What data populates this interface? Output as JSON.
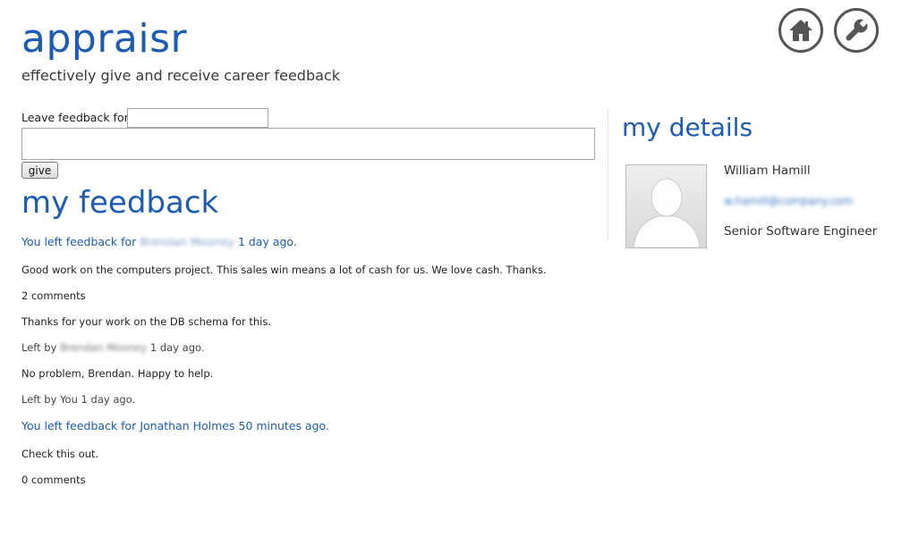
{
  "header": {
    "app_name": "appraisr",
    "tagline": "effectively give and receive career feedback"
  },
  "toolbar": {
    "home_icon": "home-icon",
    "settings_icon": "wrench-icon"
  },
  "give_form": {
    "leave_label": "Leave feedback for",
    "recipient_value": "",
    "feedback_value": "",
    "give_label": "give"
  },
  "feedback_section": {
    "heading": "my feedback",
    "items": [
      {
        "prefix": "You left feedback for",
        "recipient": "Brendan Mooney",
        "time": "1 day ago.",
        "message": "Good work on the computers project. This sales win means a lot of cash for us. We love cash. Thanks.",
        "comments_count": "2 comments",
        "comments": [
          {
            "text": "Thanks for your work on the DB schema for this.",
            "left_by_prefix": "Left by",
            "author": "Brendan Mooney",
            "time": "1 day ago."
          },
          {
            "text": "No problem, Brendan. Happy to help.",
            "left_by_prefix": "Left by",
            "author": "You",
            "time": "1 day ago."
          }
        ]
      },
      {
        "prefix": "You left feedback for",
        "recipient": "Jonathan Holmes",
        "time": "50 minutes ago.",
        "message": "Check this out.",
        "comments_count": "0 comments",
        "comments": []
      }
    ]
  },
  "details_section": {
    "heading": "my details",
    "name": "William Hamill",
    "email": "w.hamill@company.com",
    "job_title": "Senior Software Engineer",
    "avatar_icon": "default-avatar"
  },
  "colors": {
    "accent": "#1c5cb5",
    "text": "#222222"
  }
}
